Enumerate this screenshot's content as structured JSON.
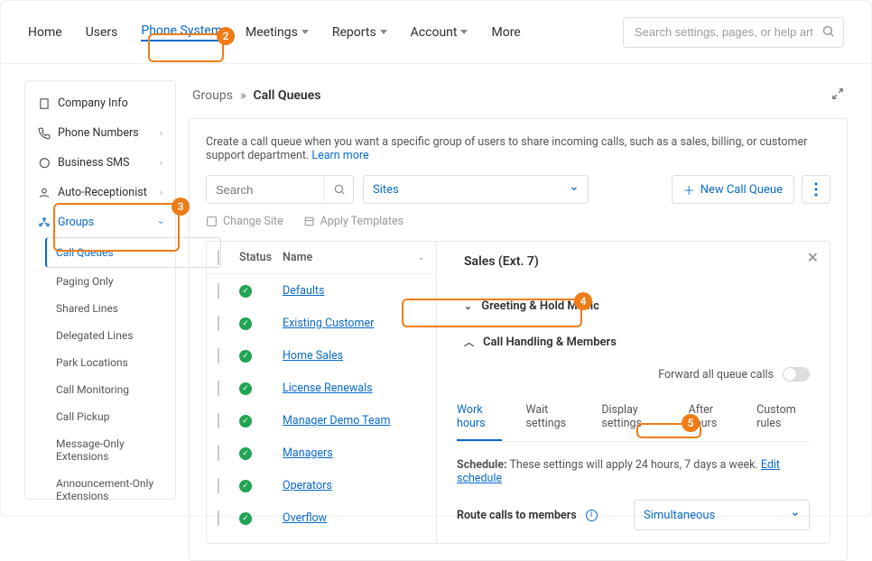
{
  "nav": {
    "home": "Home",
    "users": "Users",
    "phone_system": "Phone System",
    "meetings": "Meetings",
    "reports": "Reports",
    "account": "Account",
    "more": "More",
    "search_placeholder": "Search settings, pages, or help articles"
  },
  "sidebar": {
    "company_info": "Company Info",
    "phone_numbers": "Phone Numbers",
    "business_sms": "Business SMS",
    "auto_receptionist": "Auto-Receptionist",
    "groups": "Groups",
    "sub": {
      "call_queues": "Call Queues",
      "paging_only": "Paging Only",
      "shared_lines": "Shared Lines",
      "delegated_lines": "Delegated Lines",
      "park_locations": "Park Locations",
      "call_monitoring": "Call Monitoring",
      "call_pickup": "Call Pickup",
      "message_only": "Message-Only Extensions",
      "announcement_only": "Announcement-Only Extensions"
    }
  },
  "crumbs": {
    "groups": "Groups",
    "sep": "»",
    "call_queues": "Call Queues"
  },
  "panel": {
    "desc": "Create a call queue when you want a specific group of users to share incoming calls, such as a sales, billing, or customer support department. ",
    "learn_more": "Learn more",
    "search_placeholder": "Search",
    "sites_label": "Sites",
    "new_btn": "New Call Queue",
    "change_site": "Change Site",
    "apply_templates": "Apply Templates"
  },
  "table": {
    "status_hdr": "Status",
    "name_hdr": "Name",
    "rows": [
      {
        "name": "Defaults"
      },
      {
        "name": "Existing Customer"
      },
      {
        "name": "Home Sales"
      },
      {
        "name": "License Renewals"
      },
      {
        "name": "Manager Demo Team"
      },
      {
        "name": "Managers"
      },
      {
        "name": "Operators"
      },
      {
        "name": "Overflow"
      }
    ]
  },
  "detail": {
    "title": "Sales (Ext. 7)",
    "greeting": "Greeting & Hold Music",
    "handling": "Call Handling & Members",
    "forward_label": "Forward all queue calls",
    "tabs": {
      "work": "Work hours",
      "wait": "Wait settings",
      "display": "Display settings",
      "after": "After hours",
      "custom": "Custom rules"
    },
    "schedule_label": "Schedule:",
    "schedule_text": " These settings will apply 24 hours, 7 days a week. ",
    "edit_schedule": "Edit schedule",
    "route_label": "Route calls to members",
    "route_value": "Simultaneous"
  },
  "bubbles": {
    "b2": "2",
    "b3": "3",
    "b4": "4",
    "b5": "5"
  }
}
